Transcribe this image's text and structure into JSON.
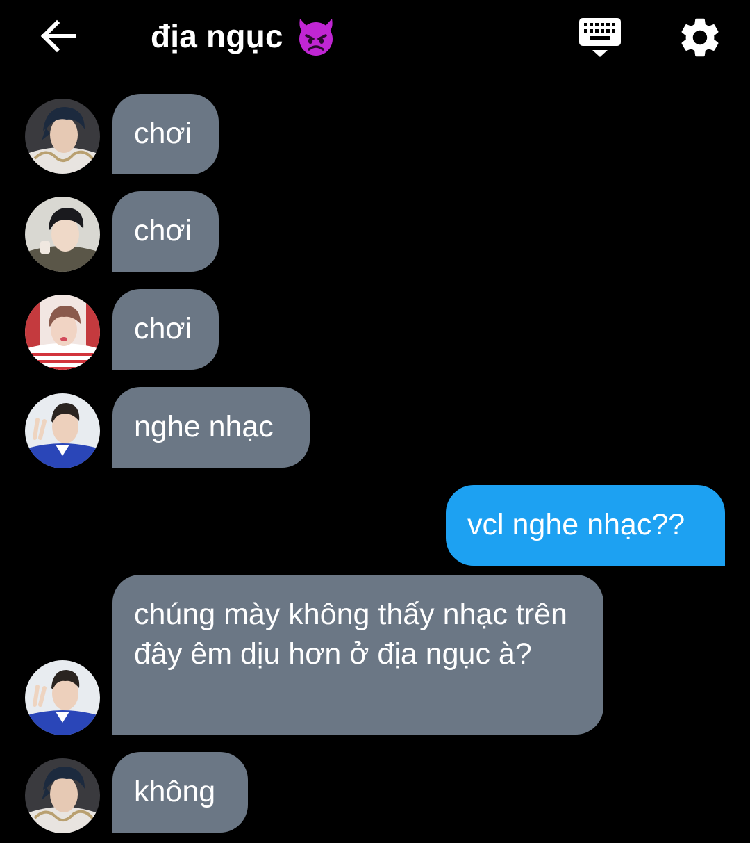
{
  "header": {
    "back_icon": "arrow-left-icon",
    "title": "địa ngục",
    "title_emoji_icon": "angry-devil-emoji-icon",
    "keyboard_icon": "keyboard-icon",
    "settings_icon": "gear-icon"
  },
  "colors": {
    "background": "#000000",
    "incoming_bubble": "#6b7785",
    "outgoing_bubble": "#1da1f2",
    "devil_emoji": "#c026d3"
  },
  "messages": [
    {
      "sender": "member",
      "avatar": "avatar-1",
      "text": "chơi"
    },
    {
      "sender": "member",
      "avatar": "avatar-2",
      "text": "chơi"
    },
    {
      "sender": "member",
      "avatar": "avatar-3",
      "text": "chơi"
    },
    {
      "sender": "member",
      "avatar": "avatar-4",
      "text": "nghe nhạc"
    },
    {
      "sender": "me",
      "text": "vcl nghe nhạc??"
    },
    {
      "sender": "member",
      "avatar": "avatar-4",
      "text": "chúng mày không thấy nhạc trên đây êm dịu hơn ở địa ngục à?"
    },
    {
      "sender": "member",
      "avatar": "avatar-1",
      "text": "không"
    }
  ]
}
